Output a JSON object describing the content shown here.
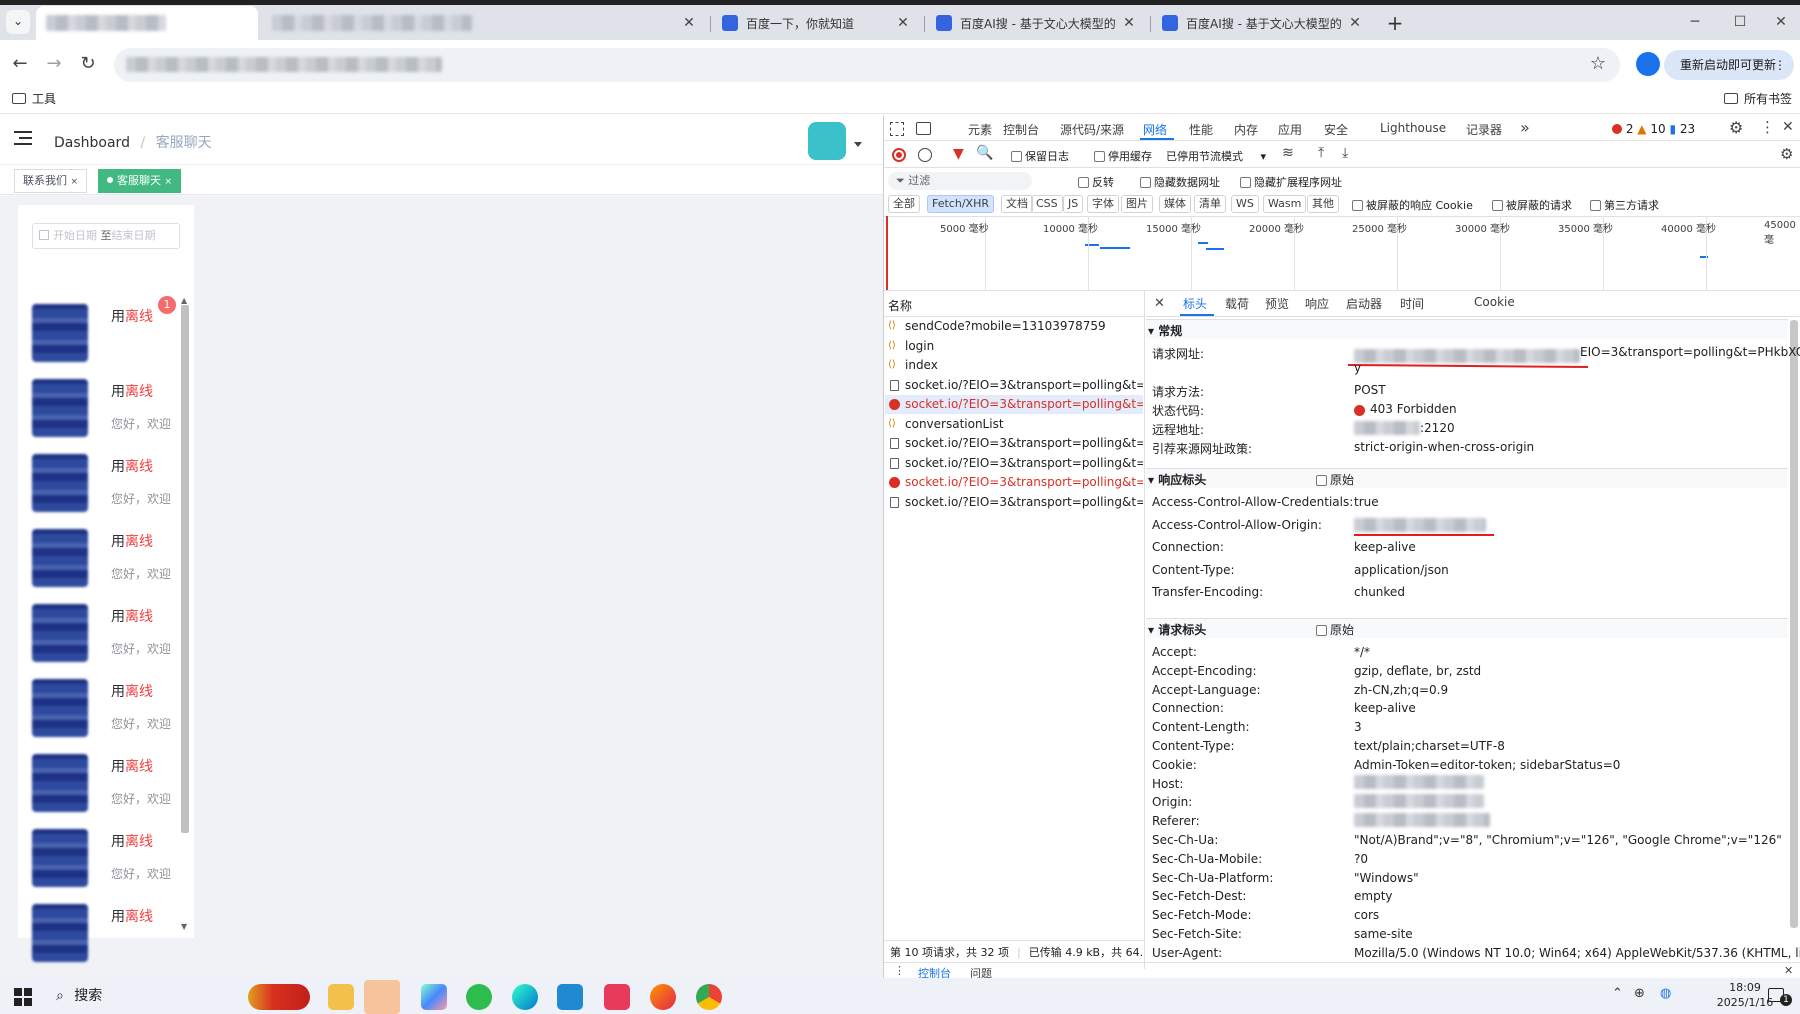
{
  "browser": {
    "tabs": [
      {
        "title": "百度一下，你就知道"
      },
      {
        "title": "百度AI搜 - 基于文心大模型的"
      },
      {
        "title": "百度AI搜 - 基于文心大模型的"
      }
    ],
    "new_tab": "+",
    "restart_button": "重新启动即可更新",
    "bookmarks": {
      "left_folder": "工具",
      "right_folder": "所有书签"
    }
  },
  "app": {
    "breadcrumb": {
      "home": "Dashboard",
      "separator": "/",
      "current": "客服聊天"
    },
    "tags": [
      {
        "label": "联系我们",
        "close": "×"
      },
      {
        "label": "客服聊天",
        "close": "×",
        "active": true
      }
    ],
    "date_range": {
      "start": "开始日期",
      "separator": "至",
      "end": "结束日期"
    },
    "unread_badge": "1",
    "conversations": [
      {
        "name_prefix": "用",
        "status": "离线",
        "message": ""
      },
      {
        "name_prefix": "用",
        "status": "离线",
        "message": "您好，欢迎"
      },
      {
        "name_prefix": "用",
        "status": "离线",
        "message": "您好，欢迎"
      },
      {
        "name_prefix": "用",
        "status": "离线",
        "message": "您好，欢迎"
      },
      {
        "name_prefix": "用",
        "status": "离线",
        "message": "您好，欢迎"
      },
      {
        "name_prefix": "用",
        "status": "离线",
        "message": "您好，欢迎"
      },
      {
        "name_prefix": "用",
        "status": "离线",
        "message": "您好，欢迎"
      },
      {
        "name_prefix": "用",
        "status": "离线",
        "message": "您好，欢迎"
      },
      {
        "name_prefix": "用",
        "status": "离线",
        "message": ""
      }
    ]
  },
  "devtools": {
    "tabs": [
      "元素",
      "控制台",
      "源代码/来源",
      "网络",
      "性能",
      "内存",
      "应用",
      "安全",
      "Lighthouse",
      "记录器"
    ],
    "more": "»",
    "counts": {
      "errors": "2",
      "warnings": "10",
      "messages": "23"
    },
    "toolbar": {
      "preserve_log": "保留日志",
      "disable_cache": "停用缓存",
      "throttle": "已停用节流模式"
    },
    "filter": {
      "placeholder": "过滤",
      "invert": "反转",
      "hide_data_urls": "隐藏数据网址",
      "hide_ext_urls": "隐藏扩展程序网址"
    },
    "type_filters": [
      "全部",
      "Fetch/XHR",
      "文档",
      "CSS",
      "JS",
      "字体",
      "图片",
      "媒体",
      "清单",
      "WS",
      "Wasm",
      "其他"
    ],
    "extra_filters": [
      "被屏蔽的响应 Cookie",
      "被屏蔽的请求",
      "第三方请求"
    ],
    "timeline_ticks": [
      "5000 毫秒",
      "10000 毫秒",
      "15000 毫秒",
      "20000 毫秒",
      "25000 毫秒",
      "30000 毫秒",
      "35000 毫秒",
      "40000 毫秒",
      "45000 毫"
    ],
    "name_header": "名称",
    "requests": [
      {
        "name": "sendCode?mobile=13103978759",
        "type": "xhr",
        "status": "ok"
      },
      {
        "name": "login",
        "type": "xhr",
        "status": "ok"
      },
      {
        "name": "index",
        "type": "xhr",
        "status": "ok"
      },
      {
        "name": "socket.io/?EIO=3&transport=polling&t=...",
        "type": "doc",
        "status": "ok"
      },
      {
        "name": "socket.io/?EIO=3&transport=polling&t=...",
        "type": "err",
        "status": "error",
        "selected": true
      },
      {
        "name": "conversationList",
        "type": "xhr",
        "status": "ok"
      },
      {
        "name": "socket.io/?EIO=3&transport=polling&t=...",
        "type": "doc",
        "status": "ok"
      },
      {
        "name": "socket.io/?EIO=3&transport=polling&t=...",
        "type": "doc",
        "status": "ok"
      },
      {
        "name": "socket.io/?EIO=3&transport=polling&t=...",
        "type": "err",
        "status": "error"
      },
      {
        "name": "socket.io/?EIO=3&transport=polling&t=...",
        "type": "doc",
        "status": "ok"
      }
    ],
    "status_bar": {
      "requests": "第 10 项请求，共 32 项",
      "transferred": "已传输 4.9 kB，共 64."
    },
    "detail_tabs": [
      "标头",
      "载荷",
      "预览",
      "响应",
      "启动器",
      "时间",
      "Cookie"
    ],
    "general": {
      "title": "常规",
      "rows": [
        {
          "key": "请求网址:",
          "value": "EIO=3&transport=polling&t=PHkbXO",
          "value2": "y"
        },
        {
          "key": "请求方法:",
          "value": "POST"
        },
        {
          "key": "状态代码:",
          "value": "403 Forbidden"
        },
        {
          "key": "远程地址:",
          "value": ":2120"
        },
        {
          "key": "引荐来源网址政策:",
          "value": "strict-origin-when-cross-origin"
        }
      ]
    },
    "response_headers": {
      "title": "响应标头",
      "raw": "原始",
      "rows": [
        {
          "key": "Access-Control-Allow-Credentials:",
          "value": "true"
        },
        {
          "key": "Access-Control-Allow-Origin:",
          "value": ""
        },
        {
          "key": "Connection:",
          "value": "keep-alive"
        },
        {
          "key": "Content-Type:",
          "value": "application/json"
        },
        {
          "key": "Transfer-Encoding:",
          "value": "chunked"
        }
      ]
    },
    "request_headers": {
      "title": "请求标头",
      "raw": "原始",
      "rows": [
        {
          "key": "Accept:",
          "value": "*/*"
        },
        {
          "key": "Accept-Encoding:",
          "value": "gzip, deflate, br, zstd"
        },
        {
          "key": "Accept-Language:",
          "value": "zh-CN,zh;q=0.9"
        },
        {
          "key": "Connection:",
          "value": "keep-alive"
        },
        {
          "key": "Content-Length:",
          "value": "3"
        },
        {
          "key": "Content-Type:",
          "value": "text/plain;charset=UTF-8"
        },
        {
          "key": "Cookie:",
          "value": "Admin-Token=editor-token; sidebarStatus=0"
        },
        {
          "key": "Host:",
          "value": ""
        },
        {
          "key": "Origin:",
          "value": ""
        },
        {
          "key": "Referer:",
          "value": ""
        },
        {
          "key": "Sec-Ch-Ua:",
          "value": "\"Not/A)Brand\";v=\"8\", \"Chromium\";v=\"126\", \"Google Chrome\";v=\"126\""
        },
        {
          "key": "Sec-Ch-Ua-Mobile:",
          "value": "?0"
        },
        {
          "key": "Sec-Ch-Ua-Platform:",
          "value": "\"Windows\""
        },
        {
          "key": "Sec-Fetch-Dest:",
          "value": "empty"
        },
        {
          "key": "Sec-Fetch-Mode:",
          "value": "cors"
        },
        {
          "key": "Sec-Fetch-Site:",
          "value": "same-site"
        },
        {
          "key": "User-Agent:",
          "value": "Mozilla/5.0 (Windows NT 10.0; Win64; x64) AppleWebKit/537.36 (KHTML, like"
        }
      ]
    },
    "drawer_tabs": [
      "控制台",
      "问题"
    ]
  },
  "taskbar": {
    "search_placeholder": "搜索",
    "time": "18:09",
    "date": "2025/1/16",
    "notification_count": "1"
  },
  "colors": {
    "accent": "#1a73e8",
    "error": "#d93025",
    "tag_active": "#42b983",
    "offline": "#f04040"
  }
}
